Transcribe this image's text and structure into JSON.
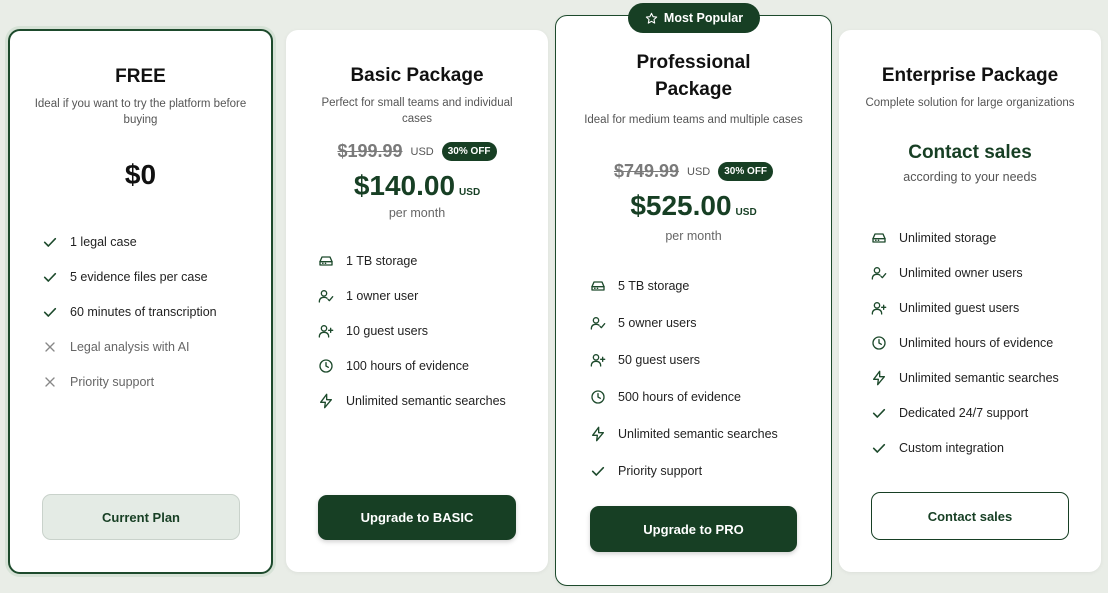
{
  "colors": {
    "brand_dark_green": "#173f24",
    "background": "#e9ede7",
    "card": "#ffffff"
  },
  "plans": {
    "free": {
      "title": "FREE",
      "description": "Ideal if you want to try the platform before buying",
      "price": "$0",
      "features": [
        {
          "icon": "check-icon",
          "text": "1 legal case"
        },
        {
          "icon": "check-icon",
          "text": "5 evidence files per case"
        },
        {
          "icon": "check-icon",
          "text": "60 minutes of transcription"
        },
        {
          "icon": "x-icon",
          "text": "Legal analysis with AI"
        },
        {
          "icon": "x-icon",
          "text": "Priority support"
        }
      ],
      "button": "Current Plan"
    },
    "basic": {
      "title": "Basic Package",
      "description": "Perfect for small teams and individual cases",
      "old_price": "$199.99",
      "old_currency": "USD",
      "discount": "30% OFF",
      "price": "$140.00",
      "currency": "USD",
      "period": "per month",
      "features": [
        {
          "icon": "storage-icon",
          "text": "1 TB storage"
        },
        {
          "icon": "user-check-icon",
          "text": "1 owner user"
        },
        {
          "icon": "user-plus-icon",
          "text": "10 guest users"
        },
        {
          "icon": "clock-icon",
          "text": "100 hours of evidence"
        },
        {
          "icon": "lightning-icon",
          "text": "Unlimited semantic searches"
        }
      ],
      "button": "Upgrade to BASIC"
    },
    "pro": {
      "badge": "Most Popular",
      "title_line1": "Professional",
      "title_line2": "Package",
      "description": "Ideal for medium teams and multiple cases",
      "old_price": "$749.99",
      "old_currency": "USD",
      "discount": "30% OFF",
      "price": "$525.00",
      "currency": "USD",
      "period": "per month",
      "features": [
        {
          "icon": "storage-icon",
          "text": "5 TB storage"
        },
        {
          "icon": "user-check-icon",
          "text": "5 owner users"
        },
        {
          "icon": "user-plus-icon",
          "text": "50 guest users"
        },
        {
          "icon": "clock-icon",
          "text": "500 hours of evidence"
        },
        {
          "icon": "lightning-icon",
          "text": "Unlimited semantic searches"
        },
        {
          "icon": "check-icon",
          "text": "Priority support"
        }
      ],
      "button": "Upgrade to PRO"
    },
    "enterprise": {
      "title": "Enterprise Package",
      "description": "Complete solution for large organizations",
      "contact_heading": "Contact sales",
      "contact_sub": "according to your needs",
      "features": [
        {
          "icon": "storage-icon",
          "text": "Unlimited storage"
        },
        {
          "icon": "user-check-icon",
          "text": "Unlimited owner users"
        },
        {
          "icon": "user-plus-icon",
          "text": "Unlimited guest users"
        },
        {
          "icon": "clock-icon",
          "text": "Unlimited hours of evidence"
        },
        {
          "icon": "lightning-icon",
          "text": "Unlimited semantic searches"
        },
        {
          "icon": "check-icon",
          "text": "Dedicated 24/7 support"
        },
        {
          "icon": "check-icon",
          "text": "Custom integration"
        }
      ],
      "button": "Contact sales"
    }
  }
}
